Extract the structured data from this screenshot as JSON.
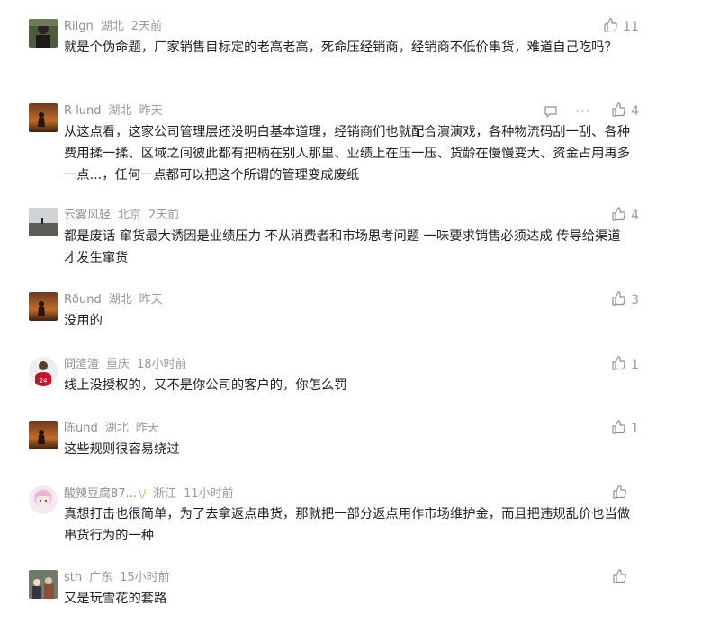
{
  "comments": [
    {
      "nick": "Rilgn",
      "region": "湖北",
      "time": "2天前",
      "text": "就是个伪命题，厂家销售目标定的老高老高，死命压经销商，经销商不低价串货，难道自己吃吗？",
      "likes": "11",
      "avatar": "man-portrait"
    },
    {
      "nick": "R-lund",
      "region": "湖北",
      "time": "昨天",
      "text": "从这点看，这家公司管理层还没明白基本道理，经销商们也就配合演演戏，各种物流码刮一刮、各种费用揉一揉、区域之间彼此都有把柄在别人那里、业绩上在压一压、货龄在慢慢变大、资金占用再多一点...，任何一点都可以把这个所谓的管理变成废纸",
      "likes": "4",
      "avatar": "sunset-figure"
    },
    {
      "nick": "云雾风轻",
      "region": "北京",
      "time": "2天前",
      "text": "都是废话  窜货最大诱因是业绩压力   不从消费者和市场思考问题  一味要求销售必须达成  传导给渠道  才发生窜货",
      "likes": "4",
      "avatar": "horizon"
    },
    {
      "nick": "Rðund",
      "region": "湖北",
      "time": "昨天",
      "text": "没用的",
      "likes": "3",
      "avatar": "sunset-figure"
    },
    {
      "nick": "冏渣渣",
      "region": "重庆",
      "time": "18小时前",
      "text": "线上没授权的，又不是你公司的客户的，你怎么罚",
      "likes": "1",
      "avatar": "basketball-player"
    },
    {
      "nick": "陈und",
      "region": "湖北",
      "time": "昨天",
      "text": "这些规则很容易绕过",
      "likes": "1",
      "avatar": "sunset-figure"
    },
    {
      "nick": "酸辣豆腐87...",
      "region": "浙江",
      "time": "11小时前",
      "text": "真想打击也很简单，为了去拿返点串货，那就把一部分返点用作市场维护金，而且把违规乱价也当做串货行为的一种",
      "likes": "",
      "avatar": "anime-girl"
    },
    {
      "nick": "sth",
      "region": "广东",
      "time": "15小时前",
      "text": "又是玩雪花的套路",
      "likes": "",
      "avatar": "group-photo"
    }
  ]
}
